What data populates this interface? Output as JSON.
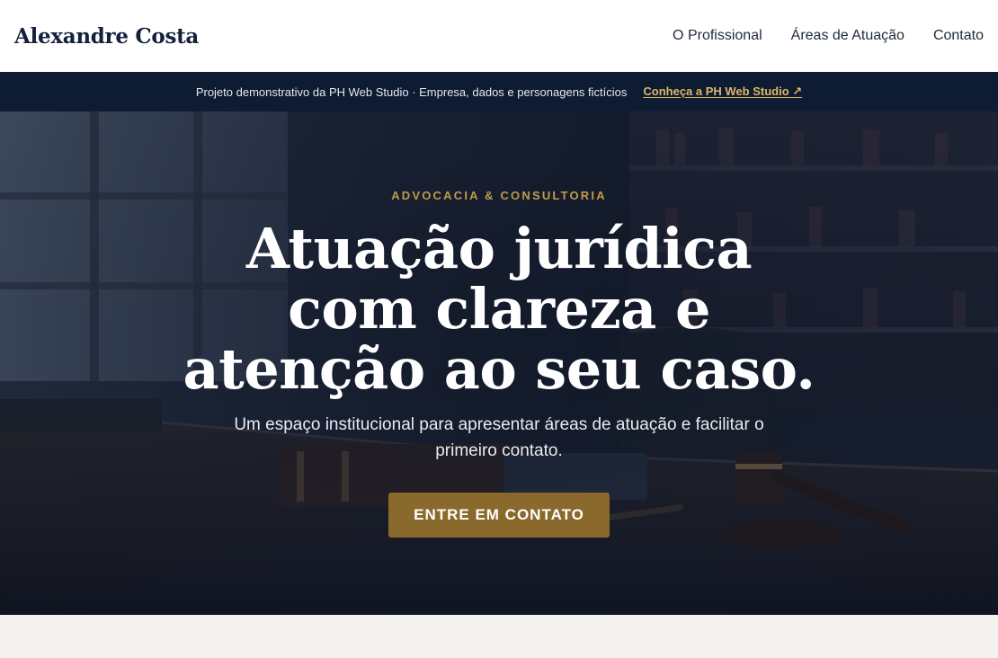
{
  "header": {
    "brand": "Alexandre Costa",
    "nav": [
      {
        "label": "O Profissional"
      },
      {
        "label": "Áreas de Atuação"
      },
      {
        "label": "Contato"
      }
    ]
  },
  "demo_banner": {
    "text": "Projeto demonstrativo da PH Web Studio · Empresa, dados e personagens fictícios",
    "link_label": "Conheça a PH Web Studio ↗"
  },
  "hero": {
    "eyebrow": "ADVOCACIA & CONSULTORIA",
    "title": "Atuação jurídica com clareza e atenção ao seu caso.",
    "subtitle": "Um espaço institucional para apresentar áreas de atuação e facilitar o primeiro contato.",
    "cta_label": "ENTRE EM CONTATO"
  },
  "colors": {
    "brand_navy": "#14213d",
    "banner_bg": "#0d1b33",
    "accent_gold": "#c19a4a",
    "button_gold": "#8a6a2c",
    "link_gold": "#e0b766"
  }
}
